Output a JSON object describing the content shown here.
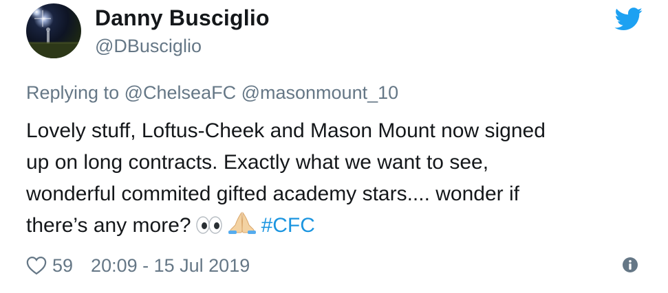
{
  "user": {
    "display_name": "Danny Busciglio",
    "handle": "@DBusciglio"
  },
  "reply": {
    "prefix": "Replying to",
    "mentions": [
      "@ChelseaFC",
      "@masonmount_10"
    ]
  },
  "tweet": {
    "lines": [
      "Lovely stuff, Loftus-Cheek and Mason Mount now signed",
      "up on long contracts. Exactly what we want to see,",
      "wonderful commited gifted academy stars.... wonder if",
      "there’s any more?"
    ],
    "emojis": [
      "eyes-emoji",
      "folded-hands-emoji"
    ],
    "hashtag": "#CFC"
  },
  "footer": {
    "likes": "59",
    "timestamp": "20:09 - 15 Jul 2019"
  },
  "icons": {
    "brand": "twitter-bird-icon",
    "like": "heart-icon",
    "info": "info-icon"
  },
  "colors": {
    "brand": "#1da1f2",
    "hashtag": "#1b95e0",
    "muted": "#657786",
    "text": "#14171a"
  }
}
